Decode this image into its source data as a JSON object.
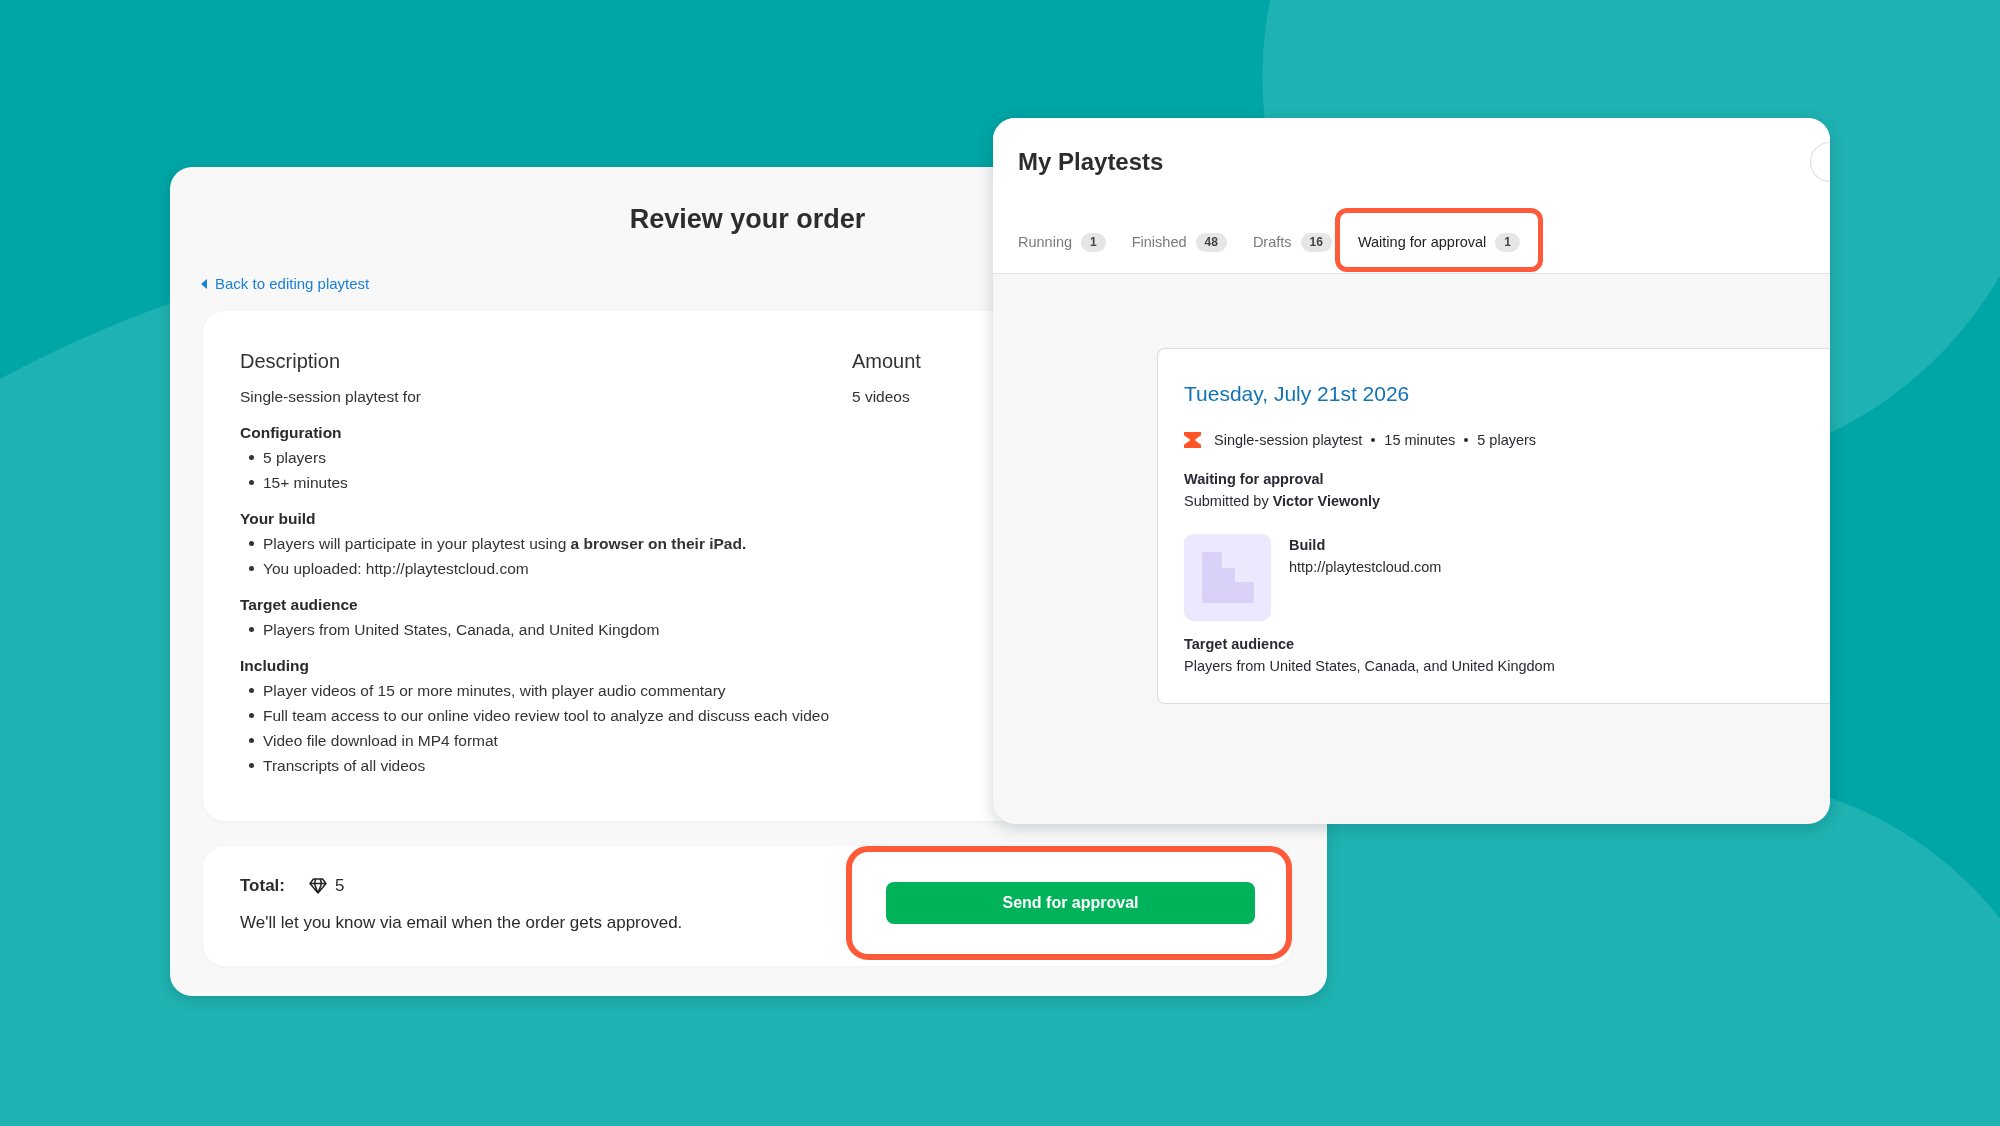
{
  "order_review": {
    "title": "Review your order",
    "back_link": "Back to editing playtest",
    "summary": {
      "columns": [
        "Description",
        "Amount"
      ],
      "item": {
        "description": "Single-session playtest for",
        "amount": "5 videos"
      },
      "sections": [
        {
          "heading": "Configuration",
          "items": [
            "5 players",
            "15+ minutes"
          ]
        },
        {
          "heading": "Your build",
          "items": [
            "Players will participate in your playtest using **a browser on their iPad.**",
            "You uploaded: http://playtestcloud.com"
          ]
        },
        {
          "heading": "Target audience",
          "items": [
            "Players from United States, Canada, and United Kingdom"
          ]
        },
        {
          "heading": "Including",
          "items": [
            "Player videos of 15 or more minutes, with player audio commentary",
            "Full team access to our online video review tool to analyze and discuss each video",
            "Video file download in MP4 format",
            "Transcripts of all videos"
          ]
        }
      ]
    },
    "total": {
      "label": "Total:",
      "amount": "5",
      "note": "We'll let you know via email when the order gets approved."
    },
    "send_button": {
      "label": "Send for approval",
      "highlighted": true
    }
  },
  "playtests": {
    "title": "My Playtests",
    "tabs": [
      {
        "label": "Running",
        "count": "1",
        "selected": false,
        "highlighted": false
      },
      {
        "label": "Finished",
        "count": "48",
        "selected": false,
        "highlighted": false
      },
      {
        "label": "Drafts",
        "count": "16",
        "selected": false,
        "highlighted": false
      },
      {
        "label": "Waiting for approval",
        "count": "1",
        "selected": true,
        "highlighted": true
      }
    ],
    "playtest": {
      "date": "Tuesday, July 21st 2026",
      "details": [
        "Single-session playtest",
        "15 minutes",
        "5 players"
      ],
      "status": "Waiting for approval",
      "submitted_by": "Submitted by **Victor Viewonly**",
      "build": {
        "label": "Build",
        "url": "http://playtestcloud.com"
      },
      "audience": {
        "label": "Target audience",
        "value": "Players from United States, Canada, and United Kingdom"
      }
    }
  }
}
